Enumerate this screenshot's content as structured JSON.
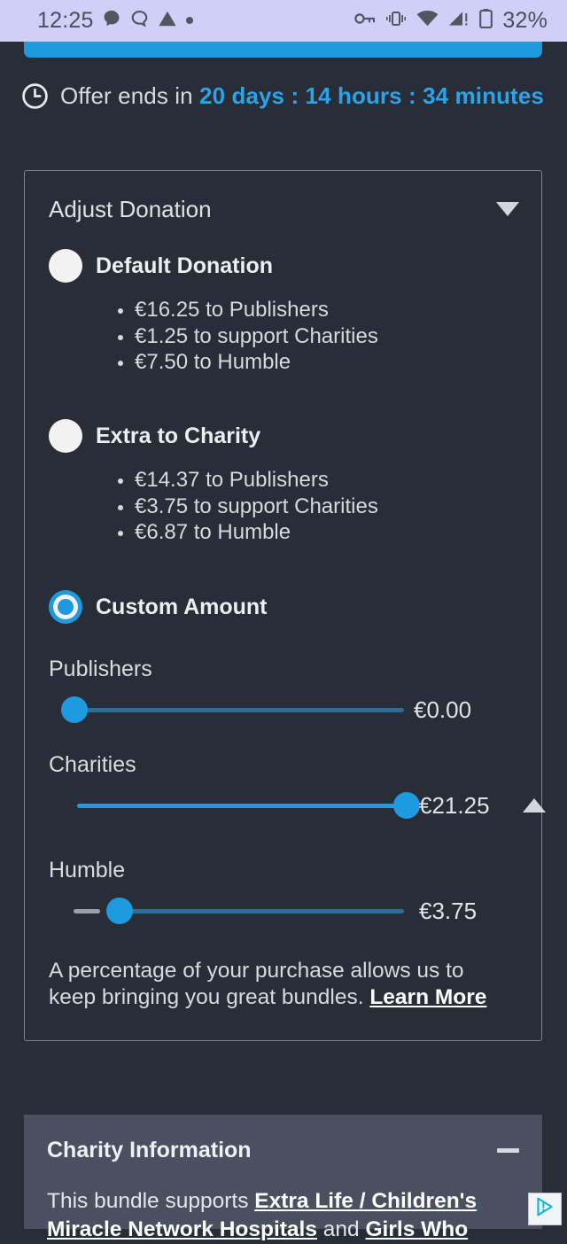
{
  "status_bar": {
    "time": "12:25",
    "battery_percent": "32%",
    "icons": [
      "message-filled-icon",
      "message-outline-icon",
      "warning-triangle-icon",
      "dot-icon",
      "vpn-key-icon",
      "vibrate-icon",
      "wifi-icon",
      "cellular-signal-icon",
      "battery-icon"
    ]
  },
  "offer": {
    "prefix": "Offer ends in ",
    "countdown": "20 days : 14 hours : 34 minutes",
    "icon": "clock-icon"
  },
  "donation": {
    "header": "Adjust Donation",
    "options": [
      {
        "id": "default",
        "label": "Default Donation",
        "selected": false,
        "breakdown": [
          "€16.25 to Publishers",
          "€1.25 to support Charities",
          "€7.50 to Humble"
        ]
      },
      {
        "id": "extra",
        "label": "Extra to Charity",
        "selected": false,
        "breakdown": [
          "€14.37 to Publishers",
          "€3.75 to support Charities",
          "€6.87 to Humble"
        ]
      },
      {
        "id": "custom",
        "label": "Custom Amount",
        "selected": true,
        "breakdown": []
      }
    ],
    "sliders": [
      {
        "label": "Publishers",
        "value": "€0.00",
        "fill_percent": 0
      },
      {
        "label": "Charities",
        "value": "€21.25",
        "fill_percent": 100
      },
      {
        "label": "Humble",
        "value": "€3.75",
        "fill_percent": 14
      }
    ],
    "note_text": "A percentage of your purchase allows us to keep bringing you great bundles. ",
    "note_link": "Learn More"
  },
  "charity_info": {
    "title": "Charity Information",
    "collapse_icon": "minus-icon",
    "body_prefix": "This bundle supports ",
    "body_link1": "Extra Life / Children's Miracle Network Hospitals",
    "body_middle": " and ",
    "body_link2": "Girls Who"
  },
  "ad_badge": {
    "icon": "adchoices-icon"
  },
  "colors": {
    "page_background": "#282d37",
    "status_bar_background": "#cfcff8",
    "accent_blue": "#1e9ae0",
    "card_border": "#7e828e",
    "charity_card_background": "#4b5060",
    "slider_inactive_track": "#2b6f99",
    "slider_gray_track": "#9aa0aa"
  }
}
